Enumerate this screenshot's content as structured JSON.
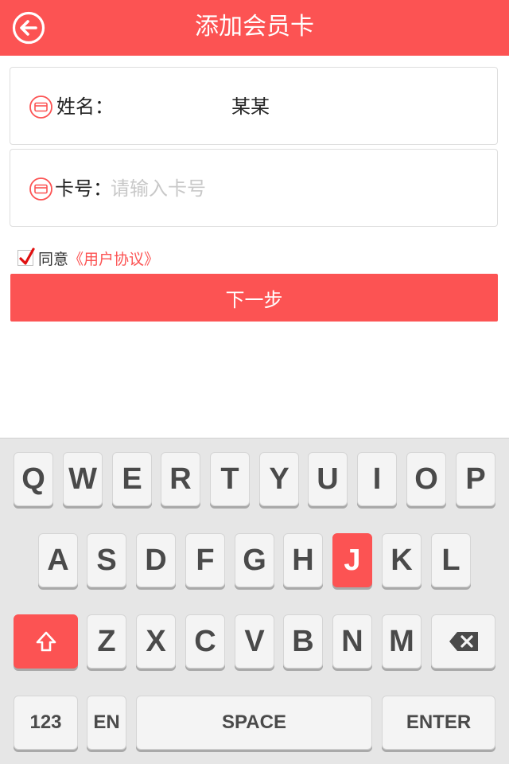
{
  "header": {
    "title": "添加会员卡",
    "back_icon": "back-arrow-icon"
  },
  "form": {
    "name": {
      "label": "姓名：",
      "value": "某某",
      "icon": "card-icon"
    },
    "card": {
      "label": "卡号：",
      "value": "",
      "placeholder": "请输入卡号",
      "icon": "card-icon"
    }
  },
  "agreement": {
    "checked": true,
    "text": "同意",
    "link": "《用户协议》"
  },
  "next_button": {
    "label": "下一步"
  },
  "keyboard": {
    "row1": [
      "Q",
      "W",
      "E",
      "R",
      "T",
      "Y",
      "U",
      "I",
      "O",
      "P"
    ],
    "row2": [
      "A",
      "S",
      "D",
      "F",
      "G",
      "H",
      "J",
      "K",
      "L"
    ],
    "row3": [
      "Z",
      "X",
      "C",
      "V",
      "B",
      "N",
      "M"
    ],
    "active_key": "J",
    "shift_icon": "shift-icon",
    "backspace_icon": "backspace-icon",
    "bottom": {
      "numbers": "123",
      "lang": "EN",
      "space": "SPACE",
      "enter": "ENTER"
    },
    "colors": {
      "accent": "#fc5353",
      "key": "#f4f4f4",
      "background": "#e6e6e6"
    }
  }
}
